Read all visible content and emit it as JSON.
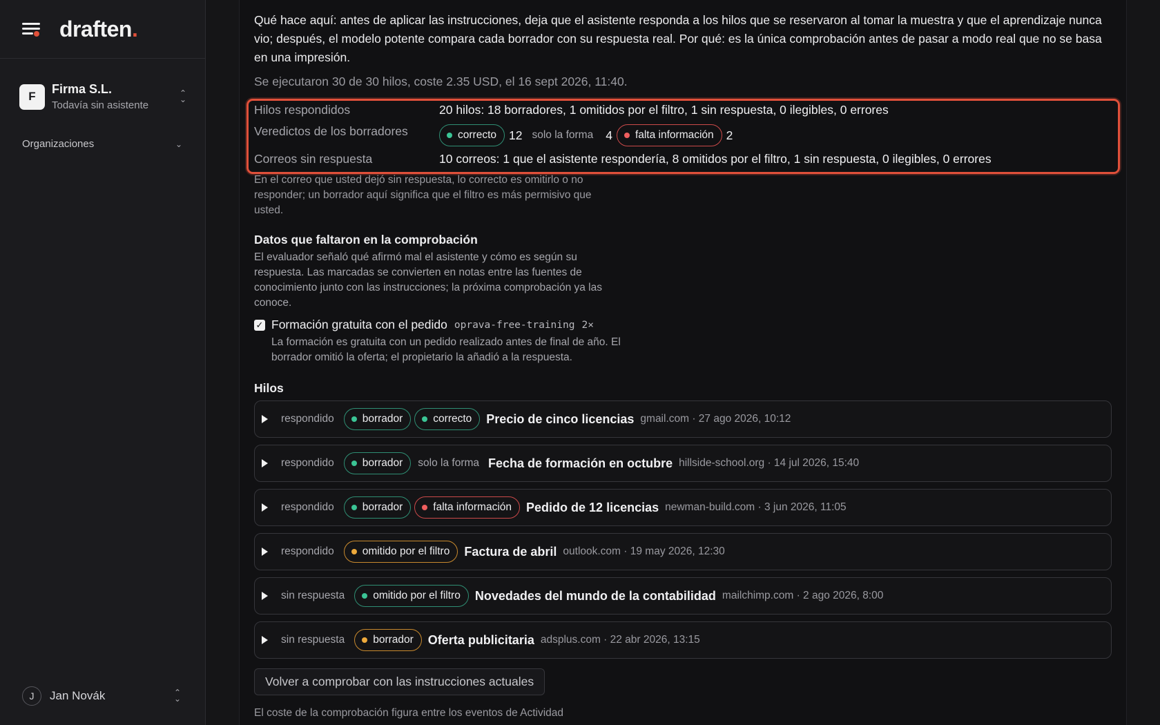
{
  "app": {
    "logo": "draften",
    "logo_dot": "."
  },
  "sidebar": {
    "org_initial": "F",
    "org_name": "Firma S.L.",
    "org_status": "Todavía sin asistente",
    "organizations_label": "Organizaciones",
    "user_initial": "J",
    "user_name": "Jan Novák"
  },
  "main": {
    "intro": "Qué hace aquí: antes de aplicar las instrucciones, deja que el asistente responda a los hilos que se reservaron al tomar la muestra y que el aprendizaje nunca vio; después, el modelo potente compara cada borrador con su respuesta real. Por qué: es la única comprobación antes de pasar a modo real que no se basa en una impresión.",
    "ran_summary": "Se ejecutaron 30 de 30 hilos, coste 2.35 USD, el 16 sept 2026, 11:40.",
    "summary": {
      "answered_label": "Hilos respondidos",
      "answered_value": "20 hilos: 18 borradores, 1 omitidos por el filtro, 1 sin respuesta, 0 ilegibles, 0 errores",
      "verdicts_label": "Veredictos de los borradores",
      "verdict_correct": "correcto",
      "verdict_correct_count": "12",
      "verdict_shape": "solo la forma",
      "verdict_shape_count": "4",
      "verdict_missing": "falta información",
      "verdict_missing_count": "2",
      "unanswered_label": "Correos sin respuesta",
      "unanswered_value": "10 correos: 1 que el asistente respondería, 8 omitidos por el filtro, 1 sin respuesta, 0 ilegibles, 0 errores"
    },
    "unanswered_note": "En el correo que usted dejó sin respuesta, lo correcto es omitirlo o no responder; un borrador aquí significa que el filtro es más permisivo que usted.",
    "missing_heading": "Datos que faltaron en la comprobación",
    "missing_desc": "El evaluador señaló qué afirmó mal el asistente y cómo es según su respuesta. Las marcadas se convierten en notas entre las fuentes de conocimiento junto con las instrucciones; la próxima comprobación ya las conoce.",
    "missing_item": {
      "checked": true,
      "title": "Formación gratuita con el pedido",
      "code": "oprava-free-training",
      "multiplier": "2×",
      "desc": "La formación es gratuita con un pedido realizado antes de final de año. El borrador omitió la oferta; el propietario la añadió a la respuesta."
    },
    "threads_heading": "Hilos",
    "threads": [
      {
        "state": "respondido",
        "tags": [
          {
            "label": "borrador",
            "color": "green"
          },
          {
            "label": "correcto",
            "color": "green"
          }
        ],
        "subject": "Precio de cinco licencias",
        "meta": "gmail.com · 27 ago 2026, 10:12"
      },
      {
        "state": "respondido",
        "tags": [
          {
            "label": "borrador",
            "color": "green"
          }
        ],
        "plain_tag": "solo la forma",
        "subject": "Fecha de formación en octubre",
        "meta": "hillside-school.org · 14 jul 2026, 15:40"
      },
      {
        "state": "respondido",
        "tags": [
          {
            "label": "borrador",
            "color": "green"
          },
          {
            "label": "falta información",
            "color": "red"
          }
        ],
        "subject": "Pedido de 12 licencias",
        "meta": "newman-build.com · 3 jun 2026, 11:05"
      },
      {
        "state": "respondido",
        "tags": [
          {
            "label": "omitido por el filtro",
            "color": "amber"
          }
        ],
        "subject": "Factura de abril",
        "meta": "outlook.com · 19 may 2026, 12:30"
      },
      {
        "state": "sin respuesta",
        "tags": [
          {
            "label": "omitido por el filtro",
            "color": "green"
          }
        ],
        "subject": "Novedades del mundo de la contabilidad",
        "meta": "mailchimp.com · 2 ago 2026, 8:00"
      },
      {
        "state": "sin respuesta",
        "tags": [
          {
            "label": "borrador",
            "color": "amber"
          }
        ],
        "subject": "Oferta publicitaria",
        "meta": "adsplus.com · 22 abr 2026, 13:15"
      }
    ],
    "recheck_button": "Volver a comprobar con las instrucciones actuales",
    "footer_note": "El coste de la comprobación figura entre los eventos de Actividad"
  }
}
